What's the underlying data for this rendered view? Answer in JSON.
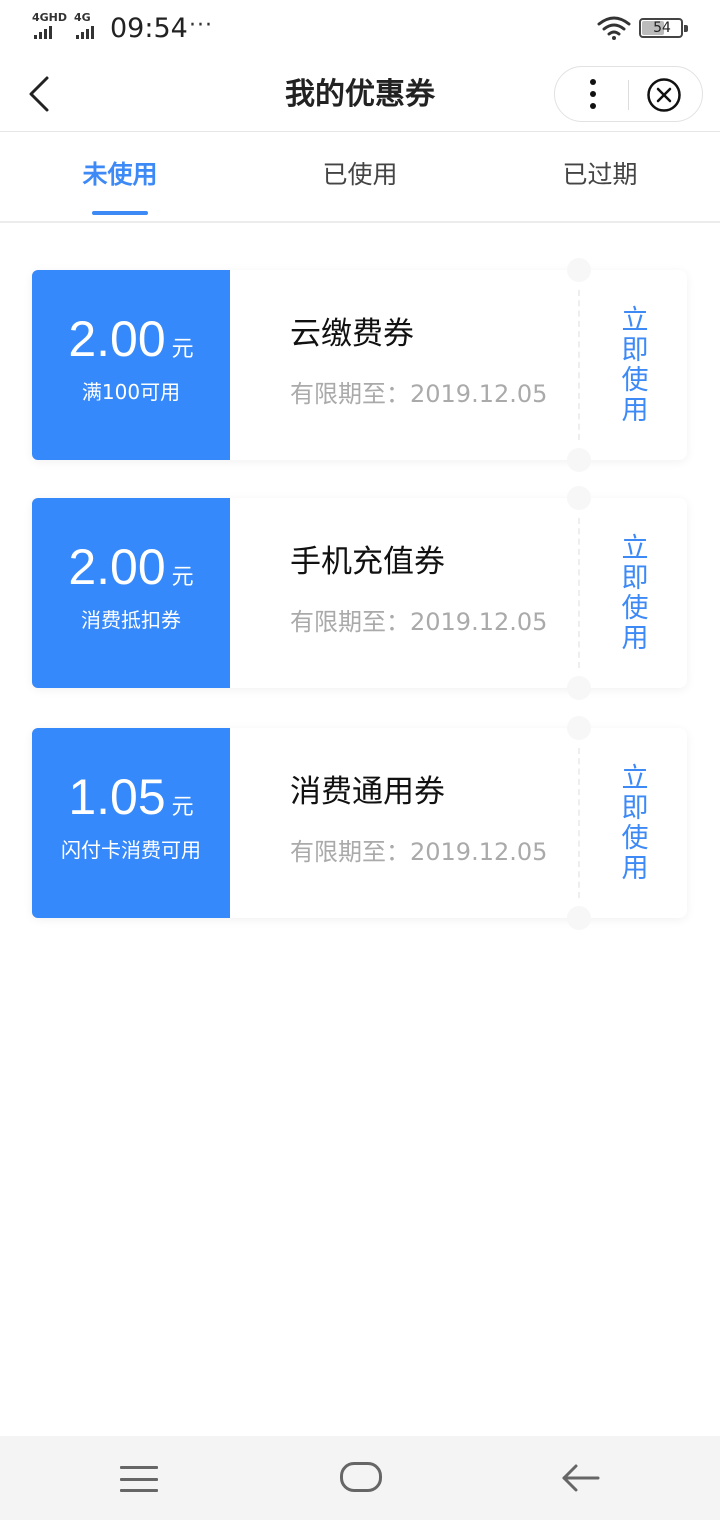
{
  "status_bar": {
    "signal1_label": "4GHD",
    "signal2_label": "4G",
    "time": "09:54",
    "more_dots": "···",
    "battery_level": "54"
  },
  "nav": {
    "title": "我的优惠券"
  },
  "tabs": [
    {
      "label": "未使用",
      "active": true
    },
    {
      "label": "已使用",
      "active": false
    },
    {
      "label": "已过期",
      "active": false
    }
  ],
  "coupons": [
    {
      "amount": "2.00",
      "unit": "元",
      "condition": "满100可用",
      "name": "云缴费券",
      "expiry": "有限期至：2019.12.05",
      "action": "立即使用"
    },
    {
      "amount": "2.00",
      "unit": "元",
      "condition": "消费抵扣券",
      "name": "手机充值券",
      "expiry": "有限期至：2019.12.05",
      "action": "立即使用"
    },
    {
      "amount": "1.05",
      "unit": "元",
      "condition": "闪付卡消费可用",
      "name": "消费通用券",
      "expiry": "有限期至：2019.12.05",
      "action": "立即使用"
    }
  ],
  "colors": {
    "accent": "#3d8af7",
    "coupon_left_bg": "#3689fa",
    "muted_text": "#aaaaaa"
  },
  "icons": {
    "back": "chevron-left-icon",
    "more": "more-vertical-icon",
    "close": "close-circle-icon",
    "wifi": "wifi-icon",
    "sys_menu": "menu-icon",
    "sys_home": "home-icon",
    "sys_back": "back-arrow-icon"
  }
}
